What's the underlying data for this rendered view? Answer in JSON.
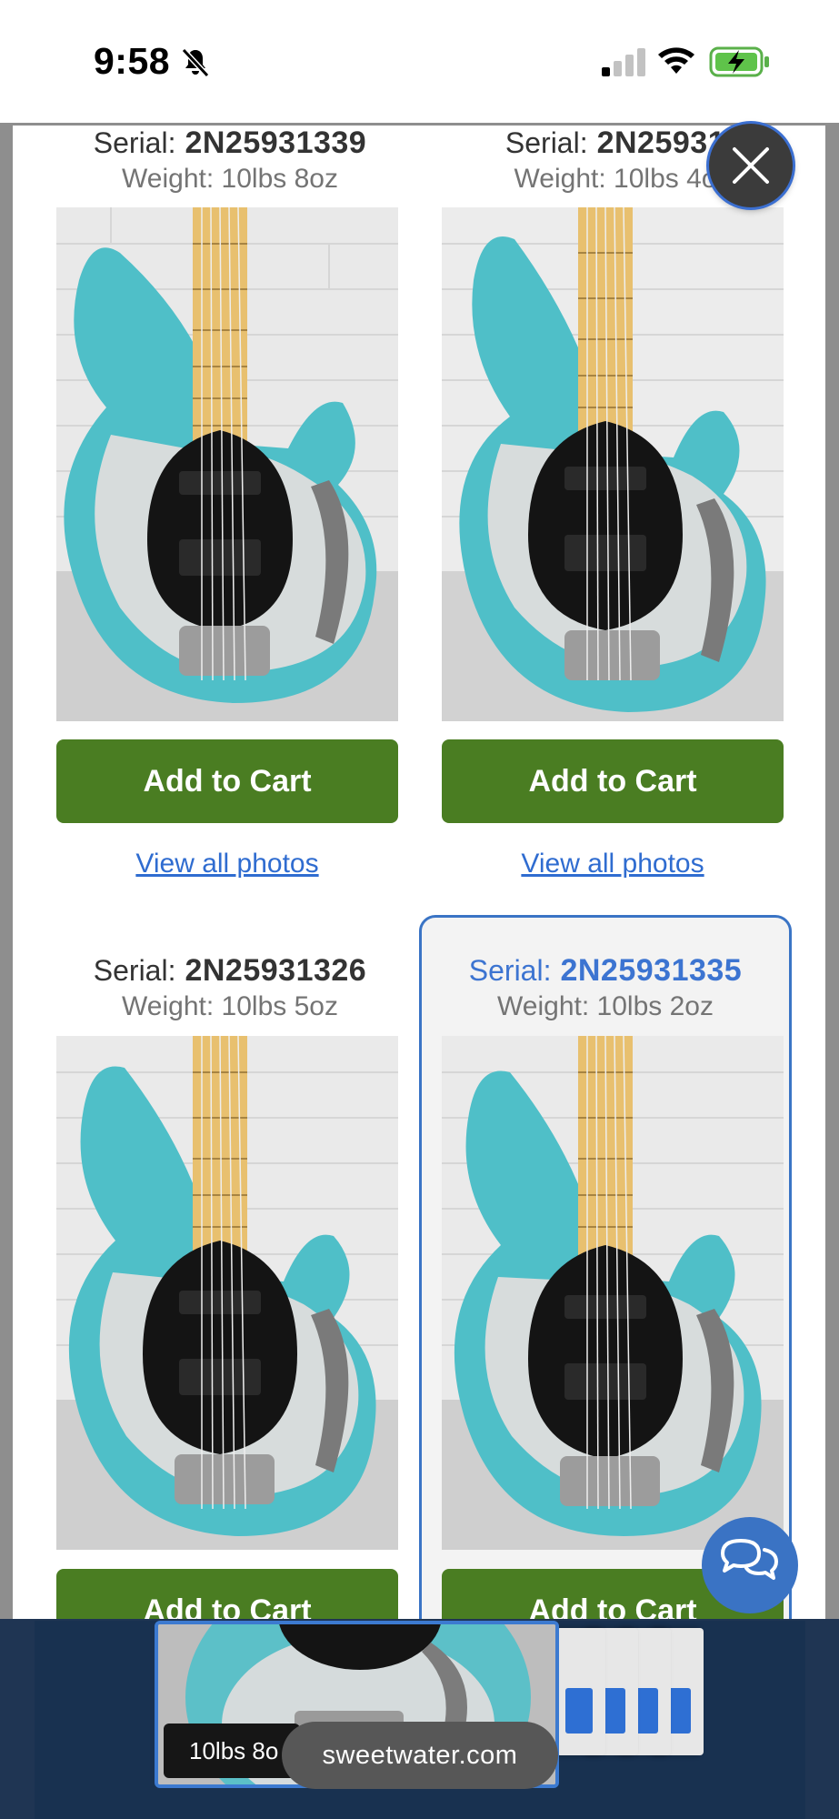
{
  "status_bar": {
    "time": "9:58"
  },
  "units": [
    {
      "serial_label": "Serial:",
      "serial": "2N25931339",
      "weight": "Weight: 10lbs 8oz",
      "add_to_cart": "Add to Cart",
      "view_photos": "View all photos"
    },
    {
      "serial_label": "Serial:",
      "serial": "2N25931",
      "weight": "Weight: 10lbs 4o",
      "add_to_cart": "Add to Cart",
      "view_photos": "View all photos"
    },
    {
      "serial_label": "Serial:",
      "serial": "2N25931326",
      "weight": "Weight: 10lbs 5oz",
      "add_to_cart": "Add to Cart"
    },
    {
      "serial_label": "Serial:",
      "serial": "2N25931335",
      "weight": "Weight: 10lbs 2oz",
      "add_to_cart": "Add to Cart",
      "selected": true
    }
  ],
  "background": {
    "weight_chip": "10lbs 8o",
    "url": "sweetwater.com"
  },
  "colors": {
    "add_to_cart": "#4a7d22",
    "link": "#2f6cd0",
    "selected_border": "#3a74c5",
    "chat_button": "#3a73c4"
  },
  "icons": {
    "close": "close-icon",
    "chat": "chat-bubbles-icon",
    "mute": "bell-slash-icon"
  }
}
